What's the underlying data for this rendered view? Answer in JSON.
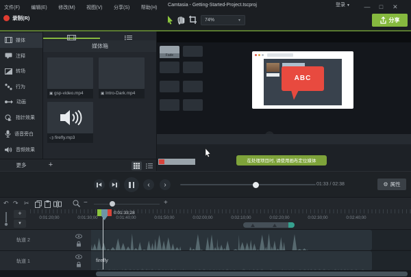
{
  "menubar": {
    "items": [
      "文件(F)",
      "编辑(E)",
      "修改(M)",
      "视图(V)",
      "分享(S)",
      "帮助(H)"
    ],
    "title": "Camtasia - Getting-Started-Project.tscproj",
    "login": "登录",
    "window_controls": {
      "minimize": "—",
      "maximize": "□",
      "close": "✕"
    }
  },
  "toolbar": {
    "record": "录制(R)",
    "zoom_level": "74%",
    "share": "分享"
  },
  "sidebar": {
    "items": [
      "媒体",
      "注释",
      "转场",
      "行为",
      "动画",
      "指针效果",
      "语音旁白",
      "音频效果"
    ],
    "more": "更多"
  },
  "media_bin": {
    "header": "媒体箱",
    "items": [
      {
        "name": "gsp-video.mp4",
        "type": "video"
      },
      {
        "name": "Intro-Dark.mp4",
        "type": "video"
      },
      {
        "name": "firefly.mp3",
        "type": "audio"
      }
    ]
  },
  "preview": {
    "video_content": {
      "fade_label": "Fade",
      "callout_text": "ABC",
      "tooltip": "在处理项目时, 请使用画布定位媒体"
    }
  },
  "playback": {
    "time_current": "01:33",
    "time_separator": "/",
    "time_total": "02:38",
    "properties_label": "属性"
  },
  "timeline": {
    "playhead_time": "0:01:33;28",
    "ruler_labels": [
      "0:01:20;00",
      "0:01:30;00",
      "0:01:40;00",
      "0:01:50;00",
      "0:02:00;00",
      "0:02:10;00",
      "0:02:20;00",
      "0:02:30;00",
      "0:02:40;00"
    ],
    "tracks": [
      {
        "name": "轨道 2"
      },
      {
        "name": "轨道 1"
      }
    ],
    "clip_label": "firefly"
  },
  "colors": {
    "accent_green": "#86b93f",
    "record_red": "#e03c31",
    "callout_red": "#e84a3f",
    "tooltip_green": "#7ea33a",
    "scroll_teal": "#35a08e"
  }
}
